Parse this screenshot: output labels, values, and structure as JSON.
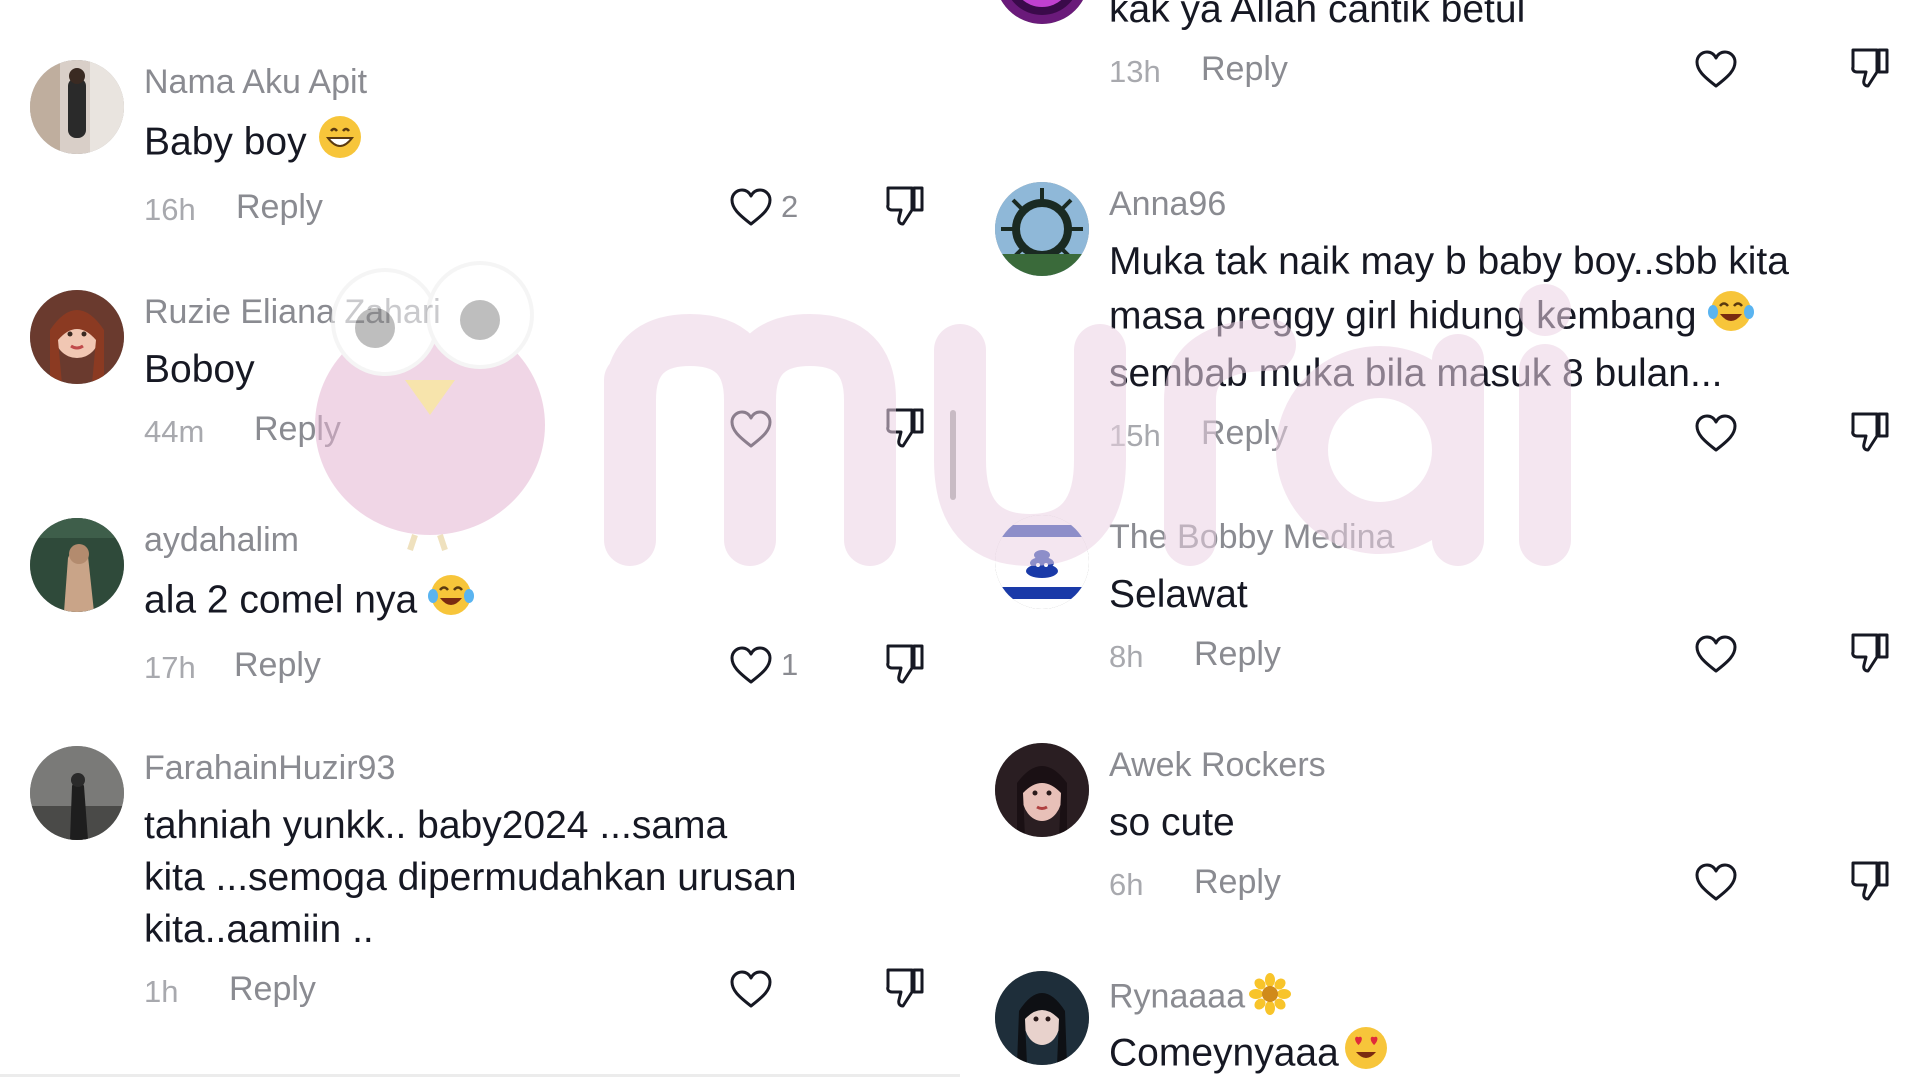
{
  "left": {
    "comments": [
      {
        "username": "Nama Aku Apit",
        "text": "Baby boy",
        "emoji": "grinning-face-emoji",
        "time": "16h",
        "reply": "Reply",
        "likes": "2"
      },
      {
        "username": "Ruzie Eliana Zahari",
        "text": "Boboy",
        "time": "44m",
        "reply": "Reply",
        "likes": ""
      },
      {
        "username": "aydahalim",
        "text": "ala 2 comel nya",
        "emoji": "tears-of-joy-emoji",
        "time": "17h",
        "reply": "Reply",
        "likes": "1"
      },
      {
        "username": "FarahainHuzir93",
        "text_lines": [
          "tahniah yunkk.. baby2024 ...sama",
          "kita ...semoga dipermudahkan urusan",
          "kita..aamiin .."
        ],
        "time": "1h",
        "reply": "Reply",
        "likes": ""
      }
    ]
  },
  "right": {
    "comments": [
      {
        "username": "",
        "text": "kak ya Allah cantik betul",
        "time": "13h",
        "reply": "Reply",
        "likes": ""
      },
      {
        "username": "Anna96",
        "text_lines": [
          "Muka tak naik may b baby boy..sbb kita",
          "masa preggy girl hidung kembang",
          "sembab muka bila masuk 8 bulan..."
        ],
        "emoji": "tears-of-joy-emoji",
        "time": "15h",
        "reply": "Reply",
        "likes": ""
      },
      {
        "username": "The Bobby Medina",
        "text": "Selawat",
        "time": "8h",
        "reply": "Reply",
        "likes": ""
      },
      {
        "username": "Awek Rockers",
        "text": "so cute",
        "time": "6h",
        "reply": "Reply",
        "likes": ""
      },
      {
        "username": "Rynaaaa",
        "username_emoji": "sunflower-emoji",
        "text": "Comeynyaaa",
        "emoji": "heart-eyes-emoji"
      }
    ]
  },
  "watermark": {
    "text": "murai"
  },
  "colors": {
    "username": "#8a8b91",
    "text": "#161823",
    "time": "#a8a9ae",
    "icon": "#161823",
    "watermark": "#e9c9dd"
  }
}
